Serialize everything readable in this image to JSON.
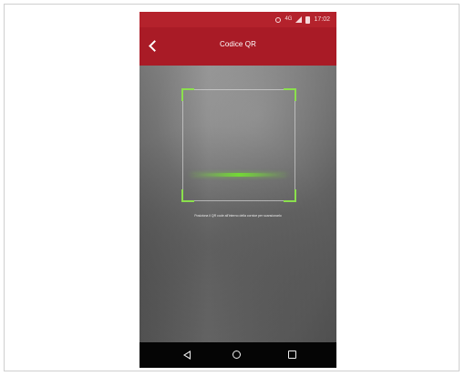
{
  "status_bar": {
    "network": "4G",
    "time": "17:02"
  },
  "app_bar": {
    "title": "Codice QR"
  },
  "scanner": {
    "instruction": "Posiziona il QR code all'interno della cornice per scansionarlo"
  },
  "colors": {
    "header": "#a91b26",
    "status_bar": "#b4222c",
    "scan_corners": "#8be04d",
    "scan_line": "#73de32"
  },
  "icons": {
    "back": "chevron-left-icon",
    "alarm": "alarm-icon",
    "signal": "signal-icon",
    "battery": "battery-icon",
    "nav_back": "nav-back-icon",
    "nav_home": "nav-home-icon",
    "nav_recent": "nav-recent-icon"
  }
}
